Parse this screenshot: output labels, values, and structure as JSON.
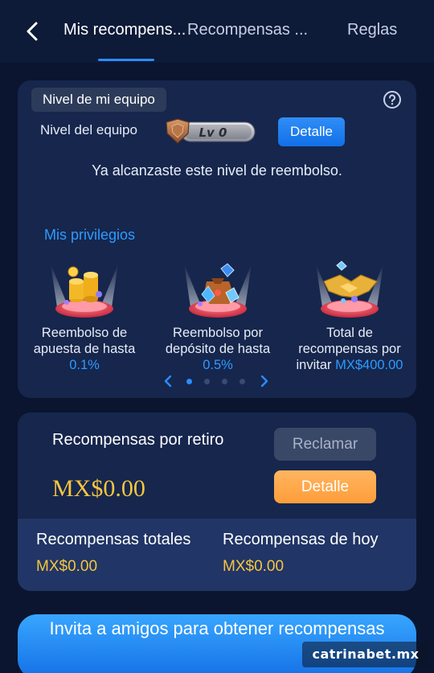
{
  "header": {
    "tabs": [
      {
        "label": "Mis recompens..."
      },
      {
        "label": "Recompensas ..."
      },
      {
        "label": "Reglas"
      }
    ]
  },
  "team": {
    "chip_label": "Nivel de mi equipo",
    "level_label": "Nivel del equipo",
    "level_badge": "Lv 0",
    "detail_button": "Detalle",
    "message": "Ya alcanzaste este nivel de reembolso."
  },
  "privileges": {
    "title": "Mis privilegios",
    "items": [
      {
        "text": "Reembolso de apuesta de hasta",
        "value": "0.1%",
        "icon": "gold-coins-icon"
      },
      {
        "text": "Reembolso por depósito de hasta",
        "value": "0.5%",
        "icon": "treasure-bag-icon"
      },
      {
        "text": "Total de recompensas por invitar",
        "value": "MX$400.00",
        "icon": "handshake-icon"
      }
    ],
    "pager": {
      "pages": 4,
      "active": 1
    }
  },
  "withdrawal": {
    "label": "Recompensas por retiro",
    "amount": "MX$0.00",
    "claim_button": "Reclamar",
    "detail_button": "Detalle",
    "total_label": "Recompensas totales",
    "total_value": "MX$0.00",
    "today_label": "Recompensas de hoy",
    "today_value": "MX$0.00"
  },
  "invite_button": "Invita a amigos para obtener recompensas",
  "watermark": "catrinabet.mx",
  "colors": {
    "accent_blue": "#2d8cff",
    "gold": "#f6c63f",
    "orange_button": "#ff9d3a",
    "background": "#0b1530",
    "card": "#16264d"
  }
}
